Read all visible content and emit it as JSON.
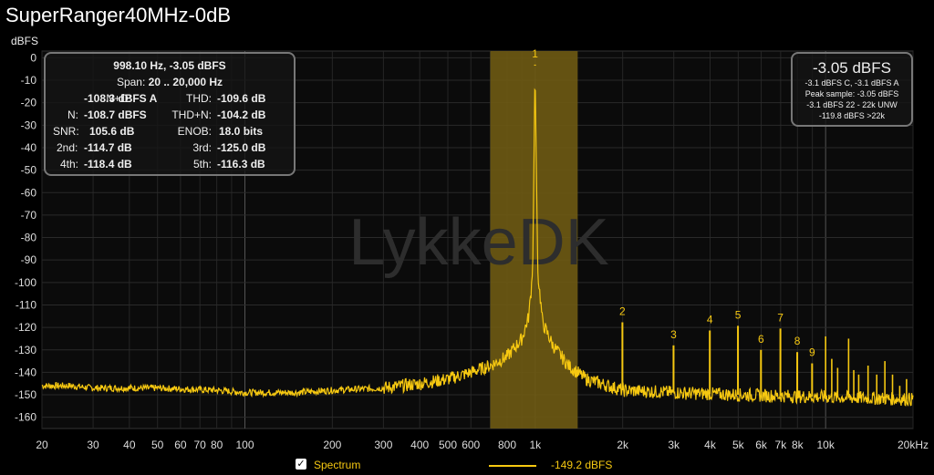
{
  "title": "SuperRanger40MHz-0dB",
  "yunit": "dBFS",
  "stats": {
    "line1_value": "998.10 Hz, -3.05 dBFS",
    "span_label": "Span:",
    "span_value": "20 .. 20,000 Hz",
    "nd_label": "N+D:",
    "nd_value": "-108.3 dBFS A",
    "thd_label": "THD:",
    "thd_value": "-109.6 dB",
    "n_label": "N:",
    "n_value": "-108.7 dBFS",
    "thdn_label": "THD+N:",
    "thdn_value": "-104.2 dB",
    "snr_label": "SNR:",
    "snr_value": "105.6 dB",
    "enob_label": "ENOB:",
    "enob_value": "18.0 bits",
    "h2_label": "2nd:",
    "h2_value": "-114.7 dB",
    "h3_label": "3rd:",
    "h3_value": "-125.0 dB",
    "h4_label": "4th:",
    "h4_value": "-118.4 dB",
    "h5_label": "5th:",
    "h5_value": "-116.3 dB"
  },
  "level": {
    "big": "-3.05 dBFS",
    "line1": "-3.1 dBFS C, -3.1 dBFS A",
    "line2": "Peak sample: -3.05 dBFS",
    "line3": "-3.1 dBFS 22 - 22k UNW",
    "line4": "-119.8 dBFS >22k"
  },
  "legend": {
    "spectrum_label": "Spectrum",
    "checked": true,
    "line_value": "-149.2 dBFS"
  },
  "watermark": "LykkeDK",
  "colors": {
    "trace": "#f6c811",
    "band": "#6e5a13",
    "grid": "#2a2a2a"
  },
  "chart_data": {
    "type": "line",
    "xscale": "log",
    "xlim": [
      20,
      20000
    ],
    "ylim": [
      -165,
      3
    ],
    "grid": true,
    "yticks": [
      0,
      -10,
      -20,
      -30,
      -40,
      -50,
      -60,
      -70,
      -80,
      -90,
      -100,
      -110,
      -120,
      -130,
      -140,
      -150,
      -160
    ],
    "xticks": [
      {
        "v": 20,
        "l": "20"
      },
      {
        "v": 30,
        "l": "30"
      },
      {
        "v": 40,
        "l": "40"
      },
      {
        "v": 50,
        "l": "50"
      },
      {
        "v": 60,
        "l": "60"
      },
      {
        "v": 70,
        "l": "70"
      },
      {
        "v": 80,
        "l": "80"
      },
      {
        "v": 100,
        "l": "100"
      },
      {
        "v": 200,
        "l": "200"
      },
      {
        "v": 300,
        "l": "300"
      },
      {
        "v": 400,
        "l": "400"
      },
      {
        "v": 500,
        "l": "500"
      },
      {
        "v": 600,
        "l": "600"
      },
      {
        "v": 800,
        "l": "800"
      },
      {
        "v": 1000,
        "l": "1k"
      },
      {
        "v": 2000,
        "l": "2k"
      },
      {
        "v": 3000,
        "l": "3k"
      },
      {
        "v": 4000,
        "l": "4k"
      },
      {
        "v": 5000,
        "l": "5k"
      },
      {
        "v": 6000,
        "l": "6k"
      },
      {
        "v": 7000,
        "l": "7k"
      },
      {
        "v": 8000,
        "l": "8k"
      },
      {
        "v": 10000,
        "l": "10k"
      },
      {
        "v": 20000,
        "l": "20kHz"
      }
    ],
    "band": [
      700,
      1400
    ],
    "noise_floor": [
      [
        20,
        -146
      ],
      [
        25,
        -146
      ],
      [
        30,
        -147
      ],
      [
        50,
        -147
      ],
      [
        80,
        -148
      ],
      [
        100,
        -149
      ],
      [
        150,
        -149
      ],
      [
        200,
        -148
      ],
      [
        300,
        -147
      ],
      [
        400,
        -145
      ],
      [
        500,
        -143
      ],
      [
        600,
        -140
      ],
      [
        700,
        -137
      ],
      [
        800,
        -133
      ],
      [
        900,
        -125
      ],
      [
        950,
        -115
      ],
      [
        980,
        -95
      ],
      [
        998,
        -3.05
      ],
      [
        1020,
        -95
      ],
      [
        1060,
        -118
      ],
      [
        1150,
        -128
      ],
      [
        1300,
        -137
      ],
      [
        1500,
        -143
      ],
      [
        2000,
        -148
      ],
      [
        3000,
        -149
      ],
      [
        5000,
        -150
      ],
      [
        10000,
        -151
      ],
      [
        20000,
        -152
      ]
    ],
    "harmonics": [
      {
        "n": "1",
        "f": 998.1,
        "db": -3.05
      },
      {
        "n": "2",
        "f": 1996,
        "db": -117.7
      },
      {
        "n": "3",
        "f": 2994,
        "db": -128.0
      },
      {
        "n": "4",
        "f": 3992,
        "db": -121.4
      },
      {
        "n": "5",
        "f": 4990,
        "db": -119.3
      },
      {
        "n": "6",
        "f": 5989,
        "db": -130.0
      },
      {
        "n": "7",
        "f": 6987,
        "db": -120.5
      },
      {
        "n": "8",
        "f": 7985,
        "db": -131.0
      },
      {
        "n": "9",
        "f": 8983,
        "db": -136.0
      }
    ],
    "other_spurs": [
      {
        "f": 10000,
        "db": -124
      },
      {
        "f": 10500,
        "db": -134
      },
      {
        "f": 11000,
        "db": -138
      },
      {
        "f": 12000,
        "db": -125
      },
      {
        "f": 12500,
        "db": -139
      },
      {
        "f": 13000,
        "db": -141
      },
      {
        "f": 14000,
        "db": -137
      },
      {
        "f": 15000,
        "db": -141
      },
      {
        "f": 16000,
        "db": -135
      },
      {
        "f": 17000,
        "db": -141
      },
      {
        "f": 18000,
        "db": -146
      },
      {
        "f": 19000,
        "db": -143
      }
    ]
  }
}
